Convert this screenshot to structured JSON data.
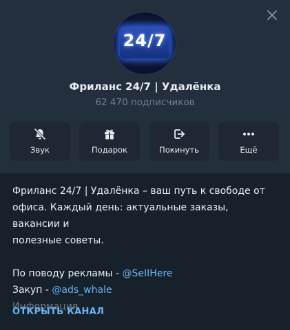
{
  "header": {
    "avatar_text": "24/7",
    "title": "Фриланс 24/7 | Удалёнка",
    "subscribers": "62 470 подписчиков"
  },
  "actions": [
    {
      "label": "Звук",
      "icon": "mute-bell-icon"
    },
    {
      "label": "Подарок",
      "icon": "gift-icon"
    },
    {
      "label": "Покинуть",
      "icon": "leave-icon"
    },
    {
      "label": "Ещё",
      "icon": "more-dots-icon"
    }
  ],
  "description": {
    "line1": "Фриланс 24/7 | Удалёнка – ваш путь к свободе от",
    "line2": "офиса. Каждый день: актуальные заказы, вакансии и",
    "line3": "полезные советы.",
    "ads_prefix": "По поводу рекламы - ",
    "ads_link": "@SeIIHere",
    "buy_prefix": "Закуп - ",
    "buy_link": "@ads_whale",
    "info_label": "Информация"
  },
  "open_channel_label": "ОТКРЫТЬ КАНАЛ",
  "colors": {
    "background": "#17212b",
    "header_bg": "#242f3d",
    "accent": "#6ab2f2",
    "muted": "#6d7f8f"
  }
}
